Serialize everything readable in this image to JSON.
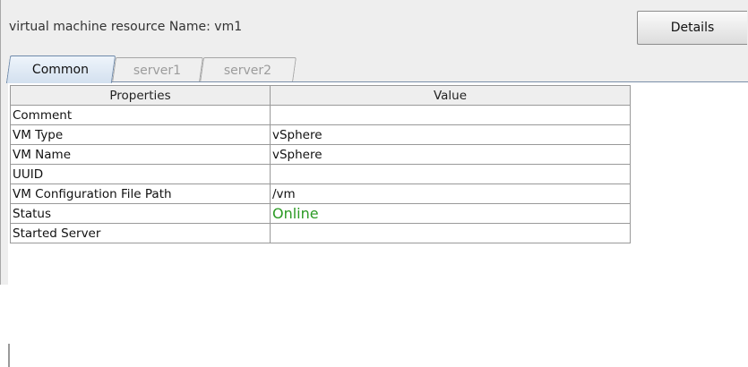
{
  "header": {
    "title": "virtual machine resource Name: vm1",
    "details_button": "Details"
  },
  "tabs": [
    {
      "label": "Common",
      "active": true
    },
    {
      "label": "server1",
      "active": false
    },
    {
      "label": "server2",
      "active": false
    }
  ],
  "table": {
    "columns": [
      "Properties",
      "Value"
    ],
    "rows": [
      {
        "property": "Comment",
        "value": ""
      },
      {
        "property": "VM Type",
        "value": "vSphere"
      },
      {
        "property": "VM Name",
        "value": "vSphere"
      },
      {
        "property": "UUID",
        "value": ""
      },
      {
        "property": "VM Configuration File Path",
        "value": "/vm"
      },
      {
        "property": "Status",
        "value": "Online"
      },
      {
        "property": "Started Server",
        "value": ""
      }
    ]
  },
  "colors": {
    "online_status": "#2b9a24",
    "active_tab_border": "#6e89aa"
  }
}
